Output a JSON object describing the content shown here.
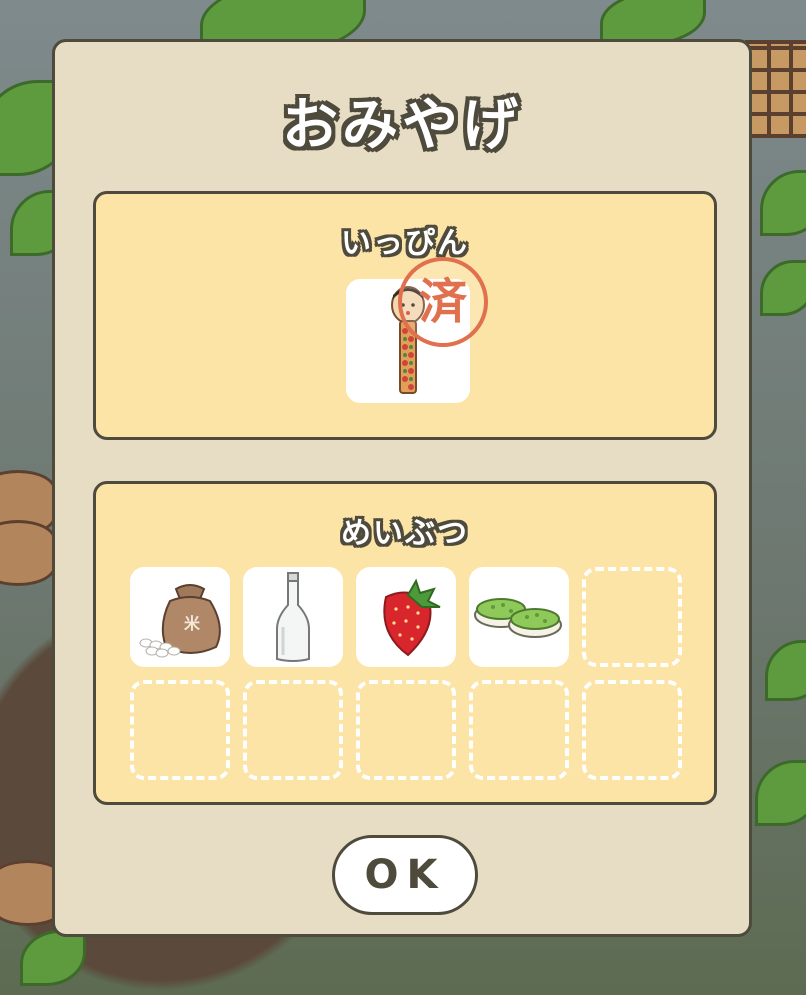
{
  "dialog": {
    "title": "おみやげ",
    "specialty_section": {
      "label": "いっぴん",
      "item": {
        "icon": "kokeshi-doll-icon",
        "stamp": "済"
      }
    },
    "local_goods_section": {
      "label": "めいぶつ",
      "items": [
        {
          "icon": "rice-bag-icon",
          "filled": true
        },
        {
          "icon": "glass-bottle-icon",
          "filled": true
        },
        {
          "icon": "strawberry-icon",
          "filled": true
        },
        {
          "icon": "zunda-mochi-icon",
          "filled": true
        },
        {
          "icon": "",
          "filled": false
        },
        {
          "icon": "",
          "filled": false
        },
        {
          "icon": "",
          "filled": false
        },
        {
          "icon": "",
          "filled": false
        },
        {
          "icon": "",
          "filled": false
        },
        {
          "icon": "",
          "filled": false
        }
      ]
    },
    "ok_label": "OK"
  },
  "colors": {
    "dialog_bg": "#e6ddc4",
    "panel_bg": "#fce3a6",
    "outline": "#4e4a3c",
    "stamp": "#e0704e"
  }
}
